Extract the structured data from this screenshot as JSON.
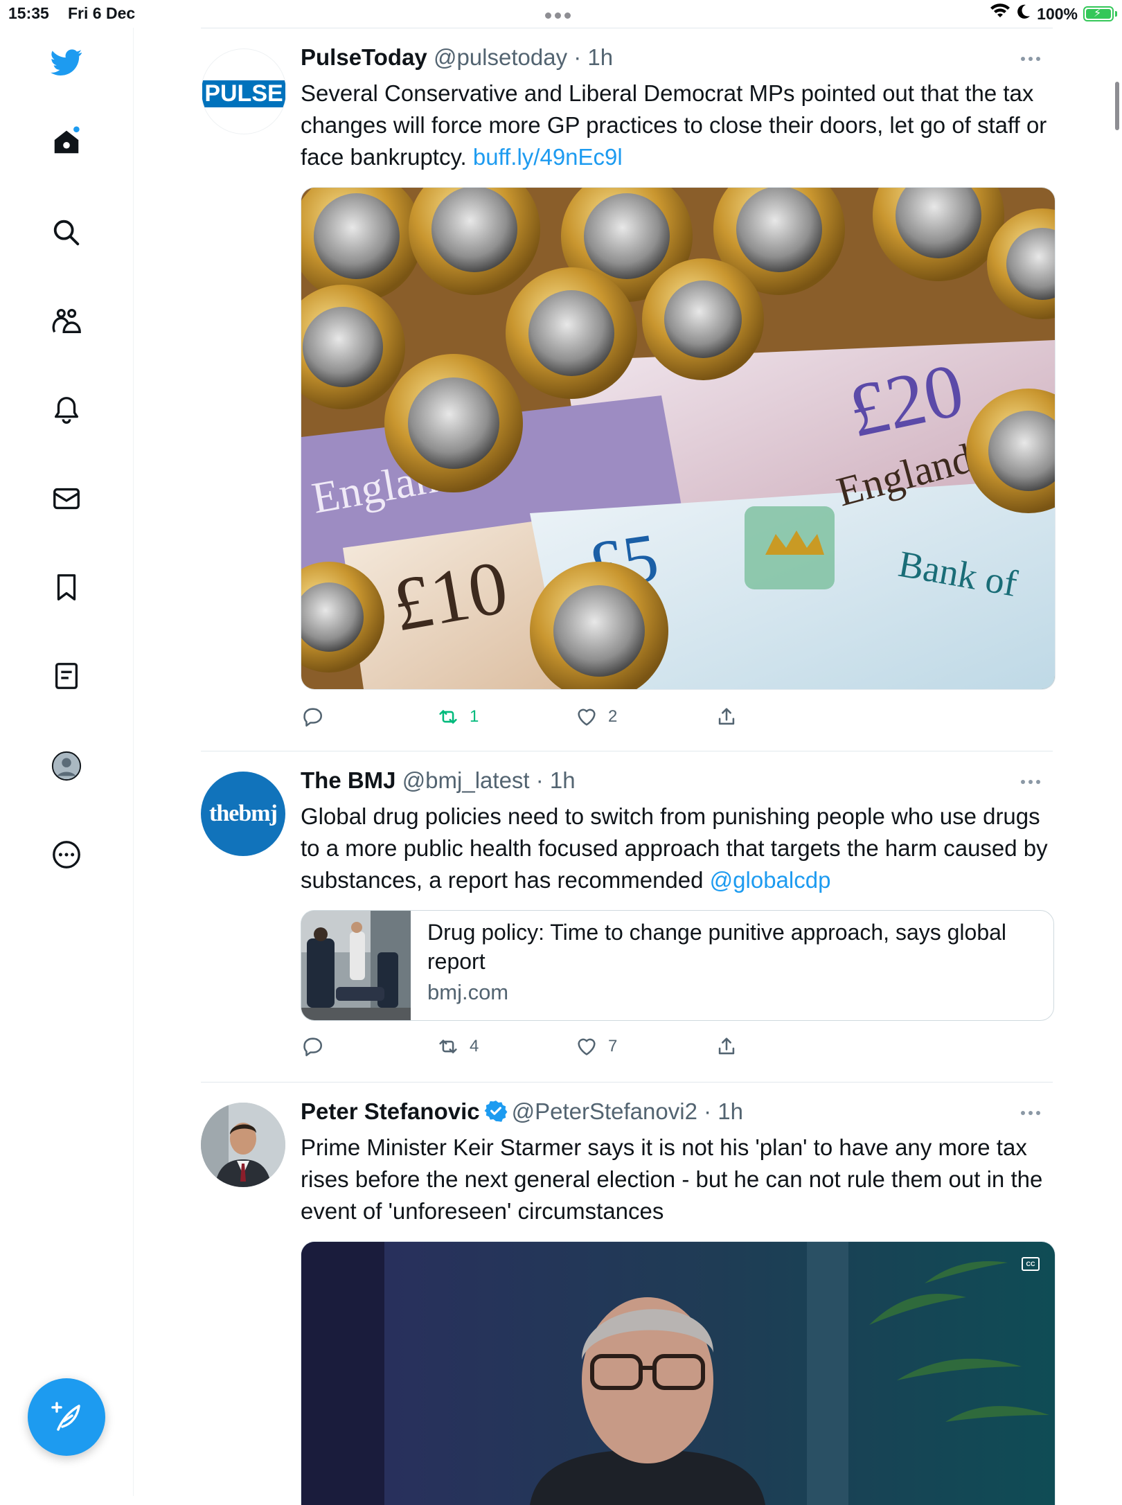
{
  "status_bar": {
    "time": "15:35",
    "date": "Fri 6 Dec",
    "battery": "100%"
  },
  "sidebar": {
    "items": [
      {
        "name": "twitter-logo"
      },
      {
        "name": "home",
        "has_notification_dot": true
      },
      {
        "name": "explore"
      },
      {
        "name": "communities"
      },
      {
        "name": "notifications"
      },
      {
        "name": "messages"
      },
      {
        "name": "bookmarks"
      },
      {
        "name": "lists"
      },
      {
        "name": "profile"
      },
      {
        "name": "more"
      }
    ],
    "compose_label": "Compose"
  },
  "colors": {
    "accent": "#1d9bf0",
    "retweet_active": "#00ba7c",
    "muted": "#536471"
  },
  "tweets": [
    {
      "name": "PulseToday",
      "handle": "@pulsetoday",
      "time": "1h",
      "avatar_text": "PULSE",
      "text": "Several Conservative and Liberal Democrat MPs pointed out that the tax changes will force more GP practices to close their doors, let go of staff or face bankruptcy. ",
      "link": "buff.ly/49nEc9l",
      "replies": "",
      "retweets": "1",
      "likes": "2"
    },
    {
      "name": "The BMJ",
      "handle": "@bmj_latest",
      "time": "1h",
      "avatar_text": "thebmj",
      "text": "Global drug policies need to switch from punishing people who use drugs to a more public health focused approach that targets the harm caused by substances, a report has recommended ",
      "mention": "@globalcdp",
      "card_title": "Drug policy: Time to change punitive approach, says global report",
      "card_domain": "bmj.com",
      "replies": "",
      "retweets": "4",
      "likes": "7"
    },
    {
      "name": "Peter Stefanovic",
      "handle": "@PeterStefanovi2",
      "time": "1h",
      "verified": true,
      "text": "Prime Minister Keir Starmer says it is not his 'plan' to have any more tax rises before the next general election - but  he can not rule them out in the event of 'unforeseen' circumstances",
      "video_badge": "CC"
    }
  ]
}
